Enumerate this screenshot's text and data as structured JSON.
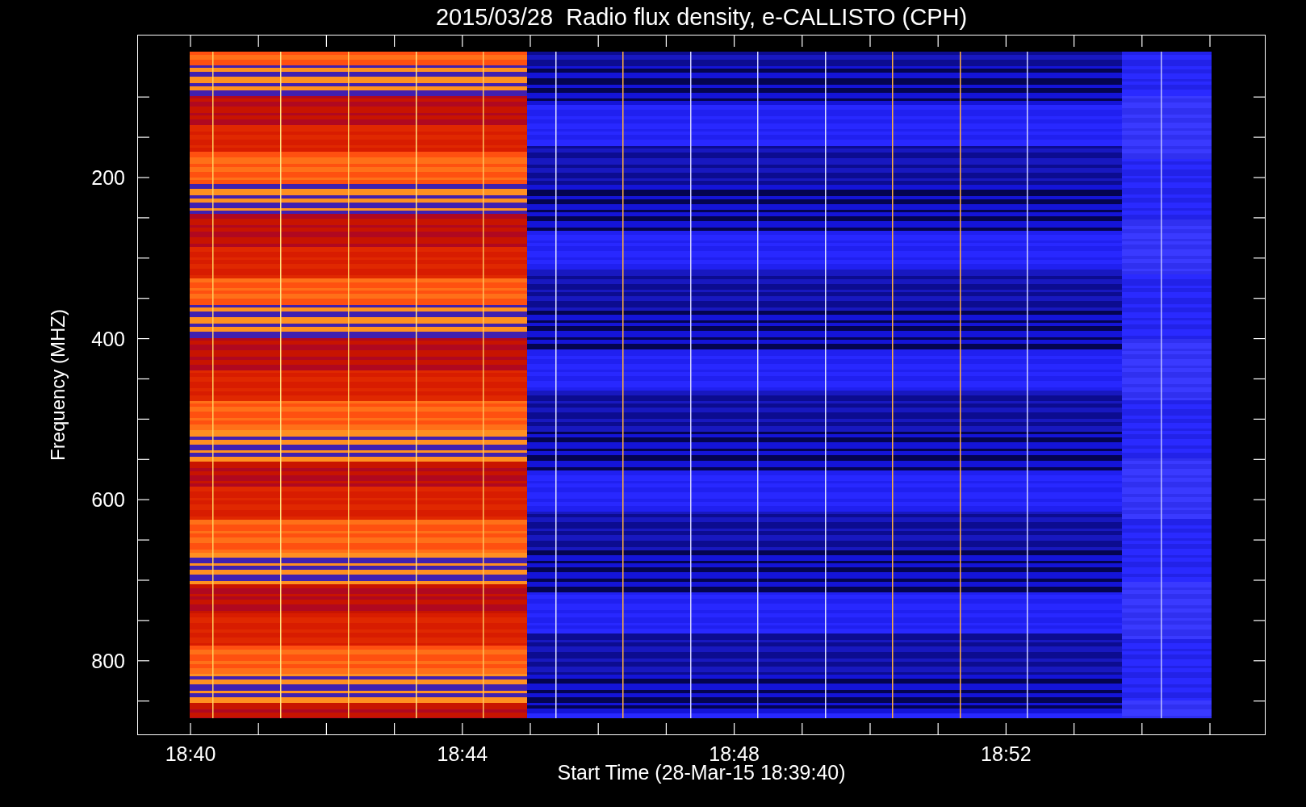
{
  "title": "2015/03/28  Radio flux density, e-CALLISTO (CPH)",
  "y_axis": {
    "label": "Frequency (MHZ)",
    "ticks": [
      "200",
      "400",
      "600",
      "800"
    ]
  },
  "x_axis": {
    "label": "Start Time (28-Mar-15 18:39:40)",
    "ticks": [
      "18:40",
      "18:44",
      "18:48",
      "18:52"
    ]
  }
}
